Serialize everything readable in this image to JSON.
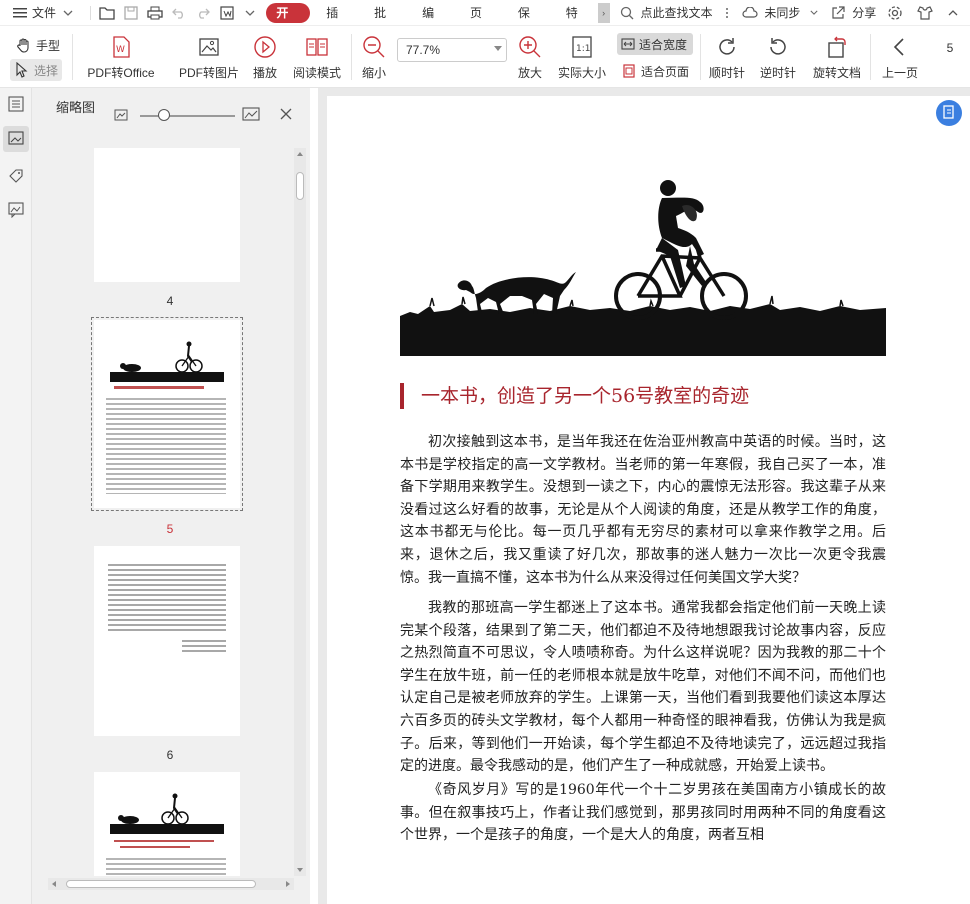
{
  "menubar": {
    "file_label": "文件",
    "tabs": [
      "开始",
      "插入",
      "批注",
      "编辑",
      "页面",
      "保护",
      "特色"
    ],
    "search_label": "点此查找文本",
    "sync_label": "未同步",
    "share_label": "分享"
  },
  "toolbar": {
    "hand_tool": "手型",
    "select_tool": "选择",
    "pdf_to_office": "PDF转Office",
    "pdf_to_image": "PDF转图片",
    "play": "播放",
    "read_mode": "阅读模式",
    "zoom_out": "缩小",
    "zoom_value": "77.7%",
    "zoom_in": "放大",
    "actual_size": "实际大小",
    "fit_width": "适合宽度",
    "fit_page": "适合页面",
    "rotate_cw": "顺时针",
    "rotate_ccw": "逆时针",
    "rotate_doc": "旋转文档",
    "prev_page": "上一页",
    "page_number": "5"
  },
  "thumbnail_panel": {
    "title": "缩略图",
    "pages": [
      "4",
      "5",
      "6"
    ],
    "selected_page": "5"
  },
  "document": {
    "title": "一本书，创造了另一个56号教室的奇迹",
    "paragraphs": [
      "初次接触到这本书，是当年我还在佐治亚州教高中英语的时候。当时，这本书是学校指定的高一文学教材。当老师的第一年寒假，我自己买了一本，准备下学期用来教学生。没想到一读之下，内心的震惊无法形容。我这辈子从来没看过这么好看的故事，无论是从个人阅读的角度，还是从教学工作的角度，这本书都无与伦比。每一页几乎都有无穷尽的素材可以拿来作教学之用。后来，退休之后，我又重读了好几次，那故事的迷人魅力一次比一次更令我震惊。我一直搞不懂，这本书为什么从来没得过任何美国文学大奖？",
      "我教的那班高一学生都迷上了这本书。通常我都会指定他们前一天晚上读完某个段落，结果到了第二天，他们都迫不及待地想跟我讨论故事内容，反应之热烈简直不可思议，令人啧啧称奇。为什么这样说呢？因为我教的那二十个学生在放牛班，前一任的老师根本就是放牛吃草，对他们不闻不问，而他们也认定自己是被老师放弃的学生。上课第一天，当他们看到我要他们读这本厚达六百多页的砖头文学教材，每个人都用一种奇怪的眼神看我，仿佛认为我是疯子。后来，等到他们一开始读，每个学生都迫不及待地读完了，远远超过我指定的进度。最令我感动的是，他们产生了一种成就感，开始爱上读书。",
      "《奇风岁月》写的是1960年代一个十二岁男孩在美国南方小镇成长的故事。但在叙事技巧上，作者让我们感觉到，那男孩同时用两种不同的角度看这个世界，一个是孩子的角度，一个是大人的角度，两者互相"
    ]
  },
  "colors": {
    "accent": "#c9333a",
    "title_red": "#a8252d",
    "blue_button": "#3b7fe0"
  }
}
